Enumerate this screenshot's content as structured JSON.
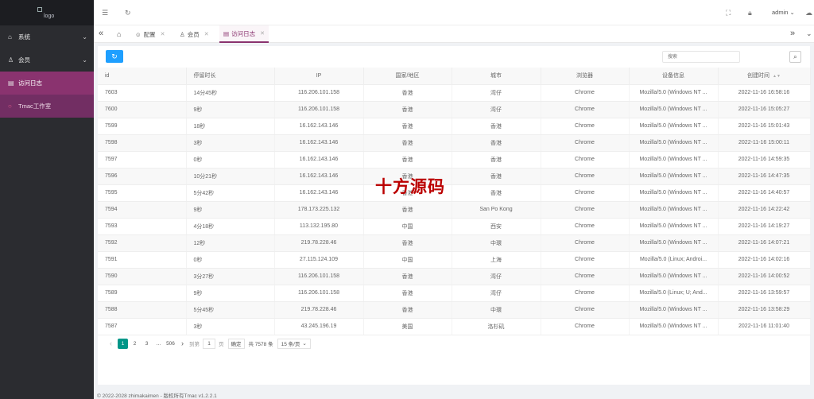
{
  "logo": {
    "alt": "logo"
  },
  "sidebar": {
    "items": [
      {
        "label": "系统",
        "icon": "home-icon",
        "expandable": true
      },
      {
        "label": "会员",
        "icon": "user-icon",
        "expandable": true
      },
      {
        "label": "访问日志",
        "icon": "log-icon",
        "expandable": false
      },
      {
        "label": "Tmac工作室",
        "icon": "circle-icon",
        "expandable": false
      }
    ]
  },
  "header": {
    "user": "admin",
    "icons": [
      "menu-fold-icon",
      "refresh-icon",
      "fullscreen-icon",
      "lock-icon",
      "chevron-down-icon",
      "theme-icon"
    ]
  },
  "tabs": [
    {
      "label": "配置",
      "icon": "smile-icon"
    },
    {
      "label": "会员",
      "icon": "user-icon"
    },
    {
      "label": "访问日志",
      "icon": "log-icon",
      "active": true
    }
  ],
  "toolbar": {
    "search_placeholder": "搜索"
  },
  "table": {
    "columns": [
      "id",
      "停留时长",
      "IP",
      "国家/地区",
      "城市",
      "浏览器",
      "设备信息",
      "创建时间"
    ],
    "rows": [
      [
        "7603",
        "14分45秒",
        "116.206.101.158",
        "香港",
        "湾仔",
        "Chrome",
        "Mozilla/5.0 (Windows NT ...",
        "2022-11-16 16:58:16"
      ],
      [
        "7600",
        "9秒",
        "116.206.101.158",
        "香港",
        "湾仔",
        "Chrome",
        "Mozilla/5.0 (Windows NT ...",
        "2022-11-16 15:05:27"
      ],
      [
        "7599",
        "18秒",
        "16.162.143.146",
        "香港",
        "香港",
        "Chrome",
        "Mozilla/5.0 (Windows NT ...",
        "2022-11-16 15:01:43"
      ],
      [
        "7598",
        "3秒",
        "16.162.143.146",
        "香港",
        "香港",
        "Chrome",
        "Mozilla/5.0 (Windows NT ...",
        "2022-11-16 15:00:11"
      ],
      [
        "7597",
        "0秒",
        "16.162.143.146",
        "香港",
        "香港",
        "Chrome",
        "Mozilla/5.0 (Windows NT ...",
        "2022-11-16 14:59:35"
      ],
      [
        "7596",
        "10分21秒",
        "16.162.143.146",
        "香港",
        "香港",
        "Chrome",
        "Mozilla/5.0 (Windows NT ...",
        "2022-11-16 14:47:35"
      ],
      [
        "7595",
        "5分42秒",
        "16.162.143.146",
        "香港",
        "香港",
        "Chrome",
        "Mozilla/5.0 (Windows NT ...",
        "2022-11-16 14:40:57"
      ],
      [
        "7594",
        "9秒",
        "178.173.225.132",
        "香港",
        "San Po Kong",
        "Chrome",
        "Mozilla/5.0 (Windows NT ...",
        "2022-11-16 14:22:42"
      ],
      [
        "7593",
        "4分18秒",
        "113.132.195.80",
        "中国",
        "西安",
        "Chrome",
        "Mozilla/5.0 (Windows NT ...",
        "2022-11-16 14:19:27"
      ],
      [
        "7592",
        "12秒",
        "219.78.228.46",
        "香港",
        "中環",
        "Chrome",
        "Mozilla/5.0 (Windows NT ...",
        "2022-11-16 14:07:21"
      ],
      [
        "7591",
        "0秒",
        "27.115.124.109",
        "中国",
        "上海",
        "Chrome",
        "Mozilla/5.0 (Linux; Androi...",
        "2022-11-16 14:02:16"
      ],
      [
        "7590",
        "3分27秒",
        "116.206.101.158",
        "香港",
        "湾仔",
        "Chrome",
        "Mozilla/5.0 (Windows NT ...",
        "2022-11-16 14:00:52"
      ],
      [
        "7589",
        "9秒",
        "116.206.101.158",
        "香港",
        "湾仔",
        "Chrome",
        "Mozilla/5.0 (Linux; U; And...",
        "2022-11-16 13:59:57"
      ],
      [
        "7588",
        "5分45秒",
        "219.78.228.46",
        "香港",
        "中環",
        "Chrome",
        "Mozilla/5.0 (Windows NT ...",
        "2022-11-16 13:58:29"
      ],
      [
        "7587",
        "3秒",
        "43.245.196.19",
        "美国",
        "洛杉矶",
        "Chrome",
        "Mozilla/5.0 (Windows NT ...",
        "2022-11-16 11:01:40"
      ]
    ]
  },
  "pagination": {
    "pages": [
      "1",
      "2",
      "3",
      "...",
      "506"
    ],
    "current": "1",
    "goto_label": "到第",
    "goto_value": "1",
    "page_unit": "页",
    "confirm_label": "确定",
    "total": "共 7578 条",
    "page_size": "15 条/页"
  },
  "footer": {
    "text": "© 2022-2028 zhimakaimen - 版权所有Tmac v1.2.2.1"
  },
  "watermark": {
    "text": "十方源码"
  }
}
